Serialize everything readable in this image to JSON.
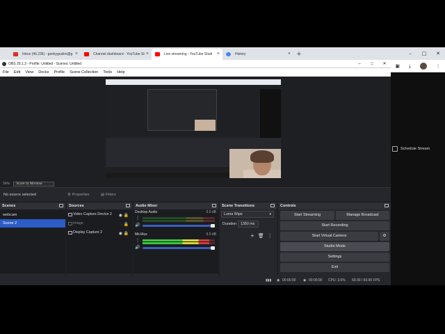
{
  "browser": {
    "tabs": [
      {
        "label": "Inbox (46,236) - geekygoslim@g",
        "favicon_color": "#d93025",
        "active": false
      },
      {
        "label": "Channel dashboard - YouTube St",
        "favicon_color": "#ff0000",
        "active": false
      },
      {
        "label": "Live streaming - YouTube Studi",
        "favicon_color": "#ff0000",
        "active": true
      },
      {
        "label": "History",
        "favicon_color": "#4285f4",
        "active": false
      }
    ],
    "new_tab": "+",
    "schedule_stream": "Schedule Stream"
  },
  "obs": {
    "title": "OBS 29.1.3 - Profile: Untitled - Scenes: Untitled",
    "menu": [
      "File",
      "Edit",
      "View",
      "Docks",
      "Profile",
      "Scene Collection",
      "Tools",
      "Help"
    ],
    "zoom": "59%",
    "scale_mode": "Scale to Window",
    "context": {
      "no_source": "No source selected",
      "properties": "Properties",
      "filters": "Filters"
    },
    "scenes": {
      "title": "Scenes",
      "items": [
        {
          "label": "webcam",
          "selected": false
        },
        {
          "label": "Scene 2",
          "selected": true
        }
      ]
    },
    "sources": {
      "title": "Sources",
      "items": [
        {
          "label": "Video Capture Device 2",
          "dim": false
        },
        {
          "label": "Image",
          "dim": true
        },
        {
          "label": "Display Capture 2",
          "dim": false
        }
      ]
    },
    "mixer": {
      "title": "Audio Mixer",
      "channels": [
        {
          "name": "Desktop Audio",
          "db": "0.0 dB",
          "level": 0.0
        },
        {
          "name": "Mic/Aux",
          "db": "0.0 dB",
          "level": 0.92
        }
      ]
    },
    "transitions": {
      "title": "Scene Transitions",
      "selected": "Luma Wipe",
      "duration_label": "Duration",
      "duration_value": "1350 ms"
    },
    "controls": {
      "title": "Controls",
      "start_streaming": "Start Streaming",
      "manage_broadcast": "Manage Broadcast",
      "start_recording": "Start Recording",
      "start_virtual_camera": "Start Virtual Camera",
      "studio_mode": "Studio Mode",
      "settings": "Settings",
      "exit": "Exit"
    },
    "status": {
      "stream_time": "00:00:00",
      "rec_time": "00:00:00",
      "cpu": "CPU: 3.6%",
      "fps": "60.00 / 60.00 FPS"
    }
  },
  "colors": {
    "accent": "#2c5cc7",
    "obs_bg": "#1e1f22",
    "panel": "#26272c"
  }
}
